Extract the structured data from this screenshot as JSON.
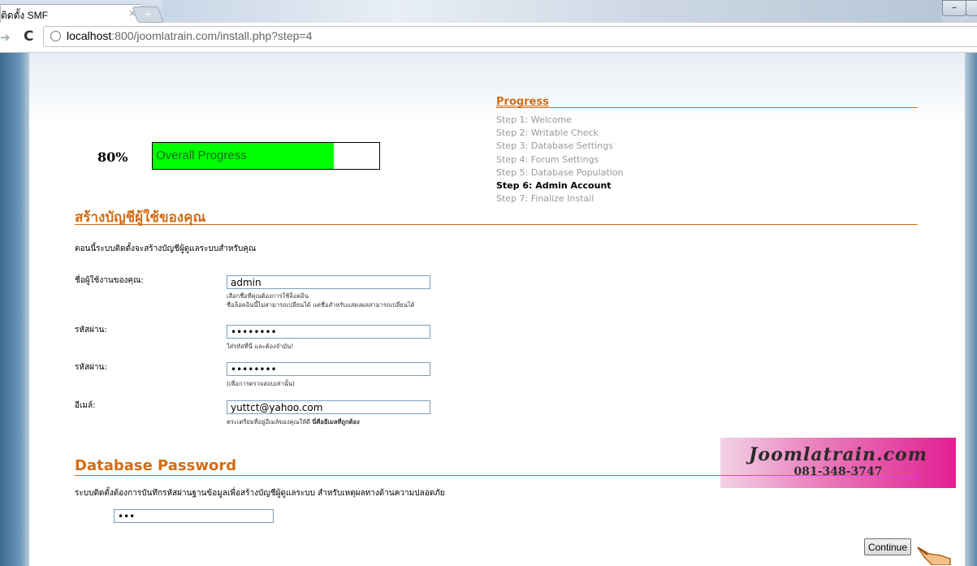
{
  "browser": {
    "tab_title": "ติดตั้ง SMF",
    "tab_close": "×",
    "new_tab": "+",
    "url_host": "localhost",
    "url_rest": ":800/joomlatrain.com/install.php?step=4"
  },
  "overall": {
    "percent_label": "80%",
    "label": "Overall Progress",
    "progress_fraction": 0.8
  },
  "progress": {
    "title": "Progress",
    "steps": [
      {
        "label": "Step 1: Welcome"
      },
      {
        "label": "Step 2: Writable Check"
      },
      {
        "label": "Step 3: Database Settings"
      },
      {
        "label": "Step 4: Forum Settings"
      },
      {
        "label": "Step 5: Database Population"
      },
      {
        "label": "Step 6: Admin Account",
        "current": true
      },
      {
        "label": "Step 7: Finalize Install"
      }
    ]
  },
  "admin": {
    "heading": "สร้างบัญชีผู้ใช้ของคุณ",
    "intro": "ตอนนี้ระบบติดตั้งจะสร้างบัญชีผู้ดูแลระบบสำหรับคุณ",
    "username": {
      "label": "ชื่อผู้ใช้งานของคุณ:",
      "value": "admin",
      "help1": "เลือกชื่อที่คุณต้องการใช้ล็อคอิน",
      "help2": "ชื่อล็อคอินนี้ไม่สามารถเปลี่ยนได้ แต่ชื่อสำหรับแสดงผลสามารถเปลี่ยนได้"
    },
    "password": {
      "label": "รหัสผ่าน:",
      "value": "••••••••",
      "help": "ใส่รหัสที่นี่ และต้องจำมัน!"
    },
    "password_verify": {
      "label": "รหัสผ่าน:",
      "value": "••••••••",
      "help": "(เพื่อการตรวจสอบเท่านั้น)"
    },
    "email": {
      "label": "อีเมล์:",
      "value": "yuttct@yahoo.com",
      "help": "ตระเตรียมที่อยู่อีเมล์ของคุณให้ดี",
      "help_bold": "นี่คืออีเมลที่ถูกต้อง"
    }
  },
  "database": {
    "heading": "Database Password",
    "description": "ระบบติดตั้งต้องการบันทึกรหัสผ่านฐานข้อมูลเพื่อสร้างบัญชีผู้ดูแลระบบ สำหรับเหตุผลทางด้านความปลอดภัย",
    "value": "•••"
  },
  "watermark": {
    "line1": "Joomlatrain.com",
    "line2": "081-348-3747"
  },
  "continue_label": "Continue"
}
